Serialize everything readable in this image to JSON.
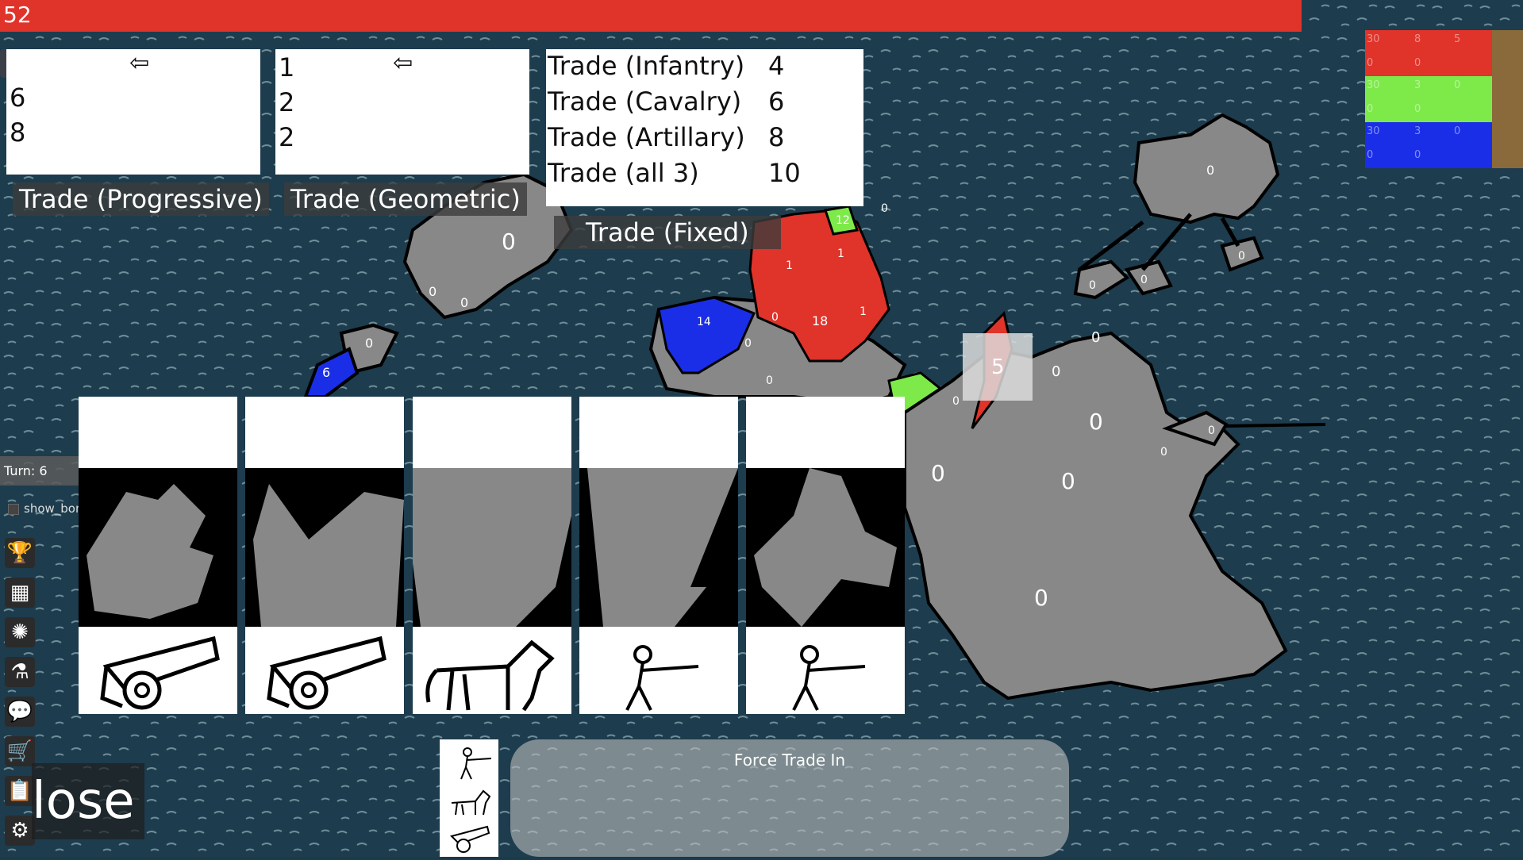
{
  "timer": {
    "value": "52"
  },
  "trade_progressive": {
    "numbers": [
      "6",
      "8"
    ],
    "label": "Trade (Progressive)",
    "arrow": "⇦"
  },
  "trade_geometric": {
    "numbers": [
      "1",
      "2",
      "2"
    ],
    "label": "Trade (Geometric)",
    "arrow": "⇦"
  },
  "trade_fixed": {
    "label": "Trade (Fixed)",
    "rows": [
      {
        "name": "Trade (Infantry)",
        "value": "4"
      },
      {
        "name": "Trade (Cavalry)",
        "value": "6"
      },
      {
        "name": "Trade (Artillary)",
        "value": "8"
      },
      {
        "name": "Trade (all 3)",
        "value": "10"
      }
    ]
  },
  "players": [
    {
      "color": "#e0332a",
      "stats_top": [
        "30",
        "8",
        "5"
      ],
      "stats_bottom": [
        "0",
        "0"
      ]
    },
    {
      "color": "#7dea4a",
      "stats_top": [
        "30",
        "3",
        "0"
      ],
      "stats_bottom": [
        "0",
        "0"
      ]
    },
    {
      "color": "#1a2ee8",
      "stats_top": [
        "30",
        "3",
        "0"
      ],
      "stats_bottom": [
        "0",
        "0"
      ]
    }
  ],
  "sidebar": {
    "turn": "Turn: 6",
    "show_bonuses": "show_bonuses",
    "icons": [
      "trophy-icon",
      "calculator-icon",
      "virus-icon",
      "flask-icon",
      "chat-icon",
      "cart-icon",
      "clipboard-icon",
      "gear-icon"
    ]
  },
  "cards": [
    {
      "unit": "artillery"
    },
    {
      "unit": "artillery"
    },
    {
      "unit": "cavalry"
    },
    {
      "unit": "infantry"
    },
    {
      "unit": "infantry"
    }
  ],
  "close_button": {
    "label": "lose"
  },
  "force_trade": {
    "label": "Force Trade In"
  },
  "map_labels": {
    "t1": "0",
    "t2": "0",
    "t3": "0",
    "t4": "0",
    "t5": "0",
    "t6": "6",
    "t7": "0",
    "t8": "14",
    "t9": "0",
    "t10": "0",
    "t11": "0",
    "t12": "18",
    "t13": "1",
    "t14": "1",
    "t15": "1",
    "t16": "12",
    "t17": "0",
    "t18": "5",
    "t19": "0",
    "t20": "0",
    "t21": "0",
    "t22": "0",
    "t23": "0",
    "t24": "0",
    "t25": "0",
    "t26": "0",
    "t27": "0",
    "t28": "0",
    "t29": "0"
  }
}
